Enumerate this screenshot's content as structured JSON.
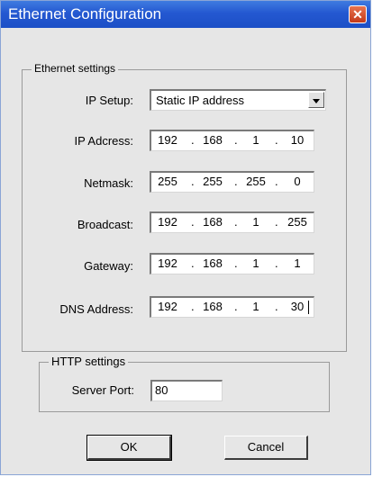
{
  "window": {
    "title": "Ethernet Configuration",
    "close_glyph": "✕"
  },
  "ethernet": {
    "group_title": "Ethernet settings",
    "ip_setup": {
      "label": "IP Setup:",
      "value": "Static IP address"
    },
    "ip_address": {
      "label": "IP Adcress:",
      "octets": [
        "192",
        "168",
        "1",
        "10"
      ]
    },
    "netmask": {
      "label": "Netmask:",
      "octets": [
        "255",
        "255",
        "255",
        "0"
      ]
    },
    "broadcast": {
      "label": "Broadcast:",
      "octets": [
        "192",
        "168",
        "1",
        "255"
      ]
    },
    "gateway": {
      "label": "Gateway:",
      "octets": [
        "192",
        "168",
        "1",
        "1"
      ]
    },
    "dns": {
      "label": "DNS Address:",
      "octets": [
        "192",
        "168",
        "1",
        "30"
      ]
    }
  },
  "http": {
    "group_title": "HTTP settings",
    "server_port": {
      "label": "Server Port:",
      "value": "80"
    }
  },
  "buttons": {
    "ok": "OK",
    "cancel": "Cancel"
  },
  "separator": "."
}
